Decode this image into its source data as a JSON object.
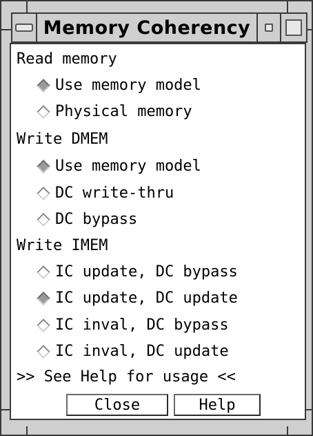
{
  "window": {
    "title": "Memory Coherency"
  },
  "sections": {
    "read": {
      "label": "Read memory",
      "options": [
        {
          "label": "Use memory model",
          "selected": true
        },
        {
          "label": "Physical memory",
          "selected": false
        }
      ]
    },
    "write_dmem": {
      "label": "Write DMEM",
      "options": [
        {
          "label": "Use memory model",
          "selected": true
        },
        {
          "label": "DC write-thru",
          "selected": false
        },
        {
          "label": "DC bypass",
          "selected": false
        }
      ]
    },
    "write_imem": {
      "label": "Write IMEM",
      "options": [
        {
          "label": "IC update, DC bypass",
          "selected": false
        },
        {
          "label": "IC update, DC update",
          "selected": true
        },
        {
          "label": "IC inval, DC bypass",
          "selected": false
        },
        {
          "label": "IC inval, DC update",
          "selected": false
        }
      ]
    }
  },
  "help_note": ">> See Help for usage <<",
  "buttons": {
    "close_label": "Close",
    "help_label": "Help"
  },
  "icons": {
    "window_menu": "window-menu-icon",
    "minimize": "minimize-icon",
    "maximize": "maximize-icon",
    "radio_on": "radio-diamond-selected-icon",
    "radio_off": "radio-diamond-unselected-icon"
  },
  "colors": {
    "frame": "#cfcfcf",
    "content_bg": "#ffffff",
    "radio_selected": "#9a9a9a"
  }
}
